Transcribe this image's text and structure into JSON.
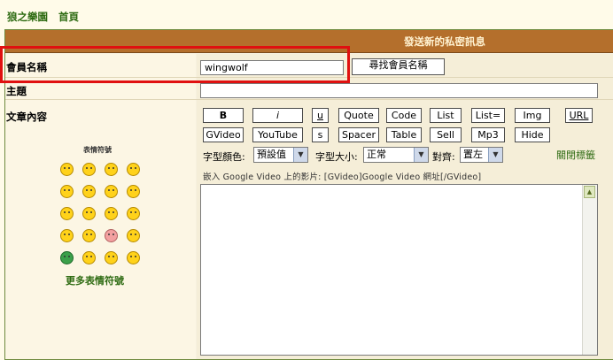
{
  "breadcrumb": {
    "site": "狼之樂園",
    "home": "首頁"
  },
  "panel": {
    "title": "發送新的私密訊息"
  },
  "form": {
    "member_label": "會員名稱",
    "member_value": "wingwolf",
    "find_member_button": "尋找會員名稱",
    "subject_label": "主題",
    "subject_value": "",
    "content_label": "文章內容"
  },
  "toolbar": {
    "row1": [
      "B",
      "i",
      "u",
      "Quote",
      "Code",
      "List",
      "List=",
      "Img",
      "URL"
    ],
    "row2": [
      "GVideo",
      "YouTube",
      "s",
      "Spacer",
      "Table",
      "Sell",
      "Mp3",
      "Hide"
    ],
    "font_color_label": "字型顏色:",
    "font_color_value": "預設值",
    "font_size_label": "字型大小:",
    "font_size_value": "正常",
    "align_label": "對齊:",
    "align_value": "置左",
    "close_tags": "關閉標籤",
    "hint": "嵌入 Google Video 上的影片: [GVideo]Google Video 網址[/GVideo]"
  },
  "emoticons": {
    "title": "表情符號",
    "more_link": "更多表情符號",
    "icons": [
      "smile-icon",
      "happy-icon",
      "sad-icon",
      "surprised-icon",
      "shocked-icon",
      "blush-icon",
      "cool-icon",
      "laugh-icon",
      "confused-icon",
      "grin-icon",
      "embarrassed-icon",
      "neutral-icon",
      "mad-icon",
      "evil-icon",
      "rolleyes-icon",
      "wink-icon",
      "teeth-icon",
      "thinking-icon",
      "arrow-icon",
      "exclaim-icon"
    ]
  },
  "colors": {
    "accent": "#b46f2c",
    "link": "#2e6b12",
    "highlight": "#e01010"
  }
}
